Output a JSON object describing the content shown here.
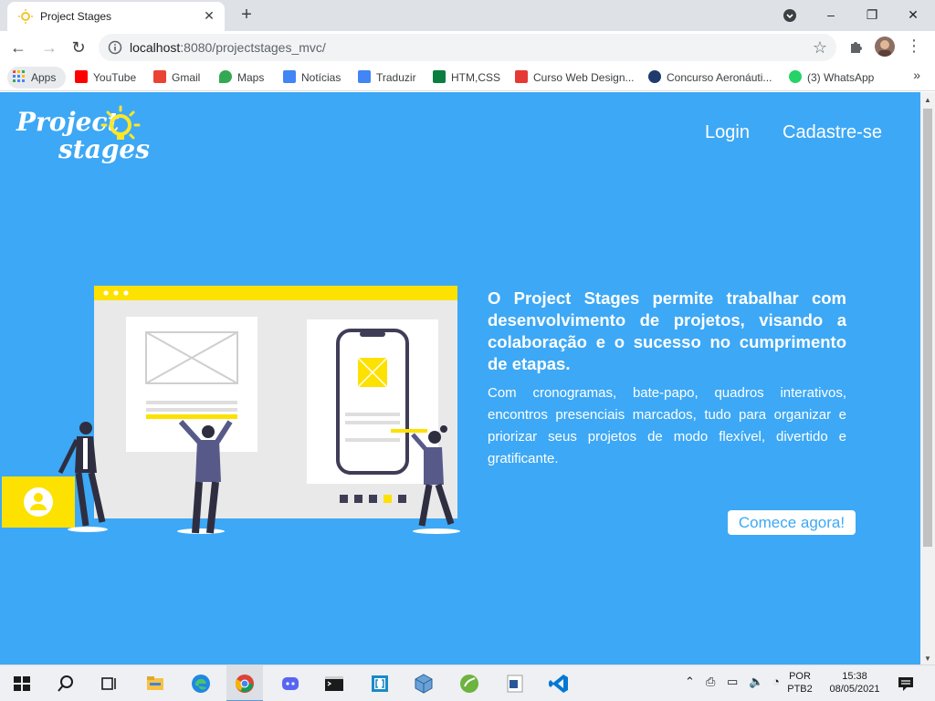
{
  "browser": {
    "tab_title": "Project Stages",
    "tab_close": "✕",
    "new_tab": "+",
    "url_host": "localhost",
    "url_rest": ":8080/projectstages_mvc/",
    "window_minimize": "–",
    "window_restore": "❐",
    "window_close": "✕"
  },
  "bookmarks": [
    {
      "label": "Apps",
      "color": "#4285f4"
    },
    {
      "label": "YouTube",
      "color": "#ff0000"
    },
    {
      "label": "Gmail",
      "color": "#ea4335"
    },
    {
      "label": "Maps",
      "color": "#34a853"
    },
    {
      "label": "Notícias",
      "color": "#4285f4"
    },
    {
      "label": "Traduzir",
      "color": "#4285f4"
    },
    {
      "label": "HTM,CSS",
      "color": "#0a7e3f"
    },
    {
      "label": "Curso Web Design...",
      "color": "#e53935"
    },
    {
      "label": "Concurso Aeronáuti...",
      "color": "#1f3b6e"
    },
    {
      "label": "(3) WhatsApp",
      "color": "#25d366"
    }
  ],
  "bookmarks_more": "»",
  "page": {
    "background": "#3da8f5",
    "logo_line1": "Project",
    "logo_line2": "stages",
    "nav_login": "Login",
    "nav_signup": "Cadastre-se",
    "hero_headline": "O Project Stages permite trabalhar com desenvolvimento de projetos, visando a colaboração e o sucesso no cumprimento de etapas.",
    "hero_body": "Com cronogramas, bate-papo, quadros interativos, encontros presenciais marcados, tudo para organizar e priorizar seus projetos de modo flexível, divertido e gratificante.",
    "cta_label": "Comece agora!"
  },
  "taskbar": {
    "lang_line1": "POR",
    "lang_line2": "PTB2",
    "time": "15:38",
    "date": "08/05/2021"
  }
}
